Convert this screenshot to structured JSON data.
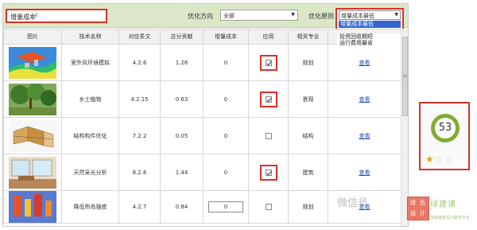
{
  "toolbar": {
    "cost_label": "增量成本",
    "cost_value": "0",
    "direction_label": "优化方向",
    "direction_value": "全部",
    "priority_label": "优化原则",
    "priority_value": "增量成本最低",
    "priority_highlight": "增量成本最低",
    "priority_options_visible": [
      "投资回收期短",
      "运行费用最省"
    ]
  },
  "table": {
    "headers": [
      "图片",
      "技术名称",
      "对应条文",
      "总分贡献",
      "增量成本",
      "应用",
      "相关专业",
      "操作"
    ],
    "rows": [
      {
        "name": "室外风环境模拟",
        "clause": "4.2.6",
        "score": "1.26",
        "cost": "0",
        "applied": true,
        "discipline": "规划",
        "action": "查看"
      },
      {
        "name": "乡土植物",
        "clause": "4.2.15",
        "score": "0.63",
        "cost": "0",
        "applied": true,
        "discipline": "景观",
        "action": "查看"
      },
      {
        "name": "结构构件优化",
        "clause": "7.2.2",
        "score": "0.05",
        "cost": "0",
        "applied": false,
        "discipline": "结构",
        "action": "查看"
      },
      {
        "name": "天然采光分析",
        "clause": "8.2.6",
        "score": "1.44",
        "cost": "0",
        "applied": true,
        "discipline": "建筑",
        "action": "查看"
      },
      {
        "name": "降低热岛强度",
        "clause": "4.2.7",
        "score": "0.84",
        "cost": "0",
        "applied": false,
        "discipline": "规划",
        "action": "查看"
      }
    ]
  },
  "score": {
    "value": "53",
    "stars_filled": 1,
    "stars_total": 3
  },
  "watermark": {
    "text": "微信号",
    "badge": [
      "绿",
      "色",
      "设",
      "计"
    ],
    "brand": "绿建课",
    "brand_sub": "绿色建筑设计服务平台"
  },
  "colors": {
    "highlight_red": "#d9302b",
    "toolbar_green": "#dce7c9",
    "score_ring": "#7fae33",
    "select_blue": "#3366cc"
  }
}
